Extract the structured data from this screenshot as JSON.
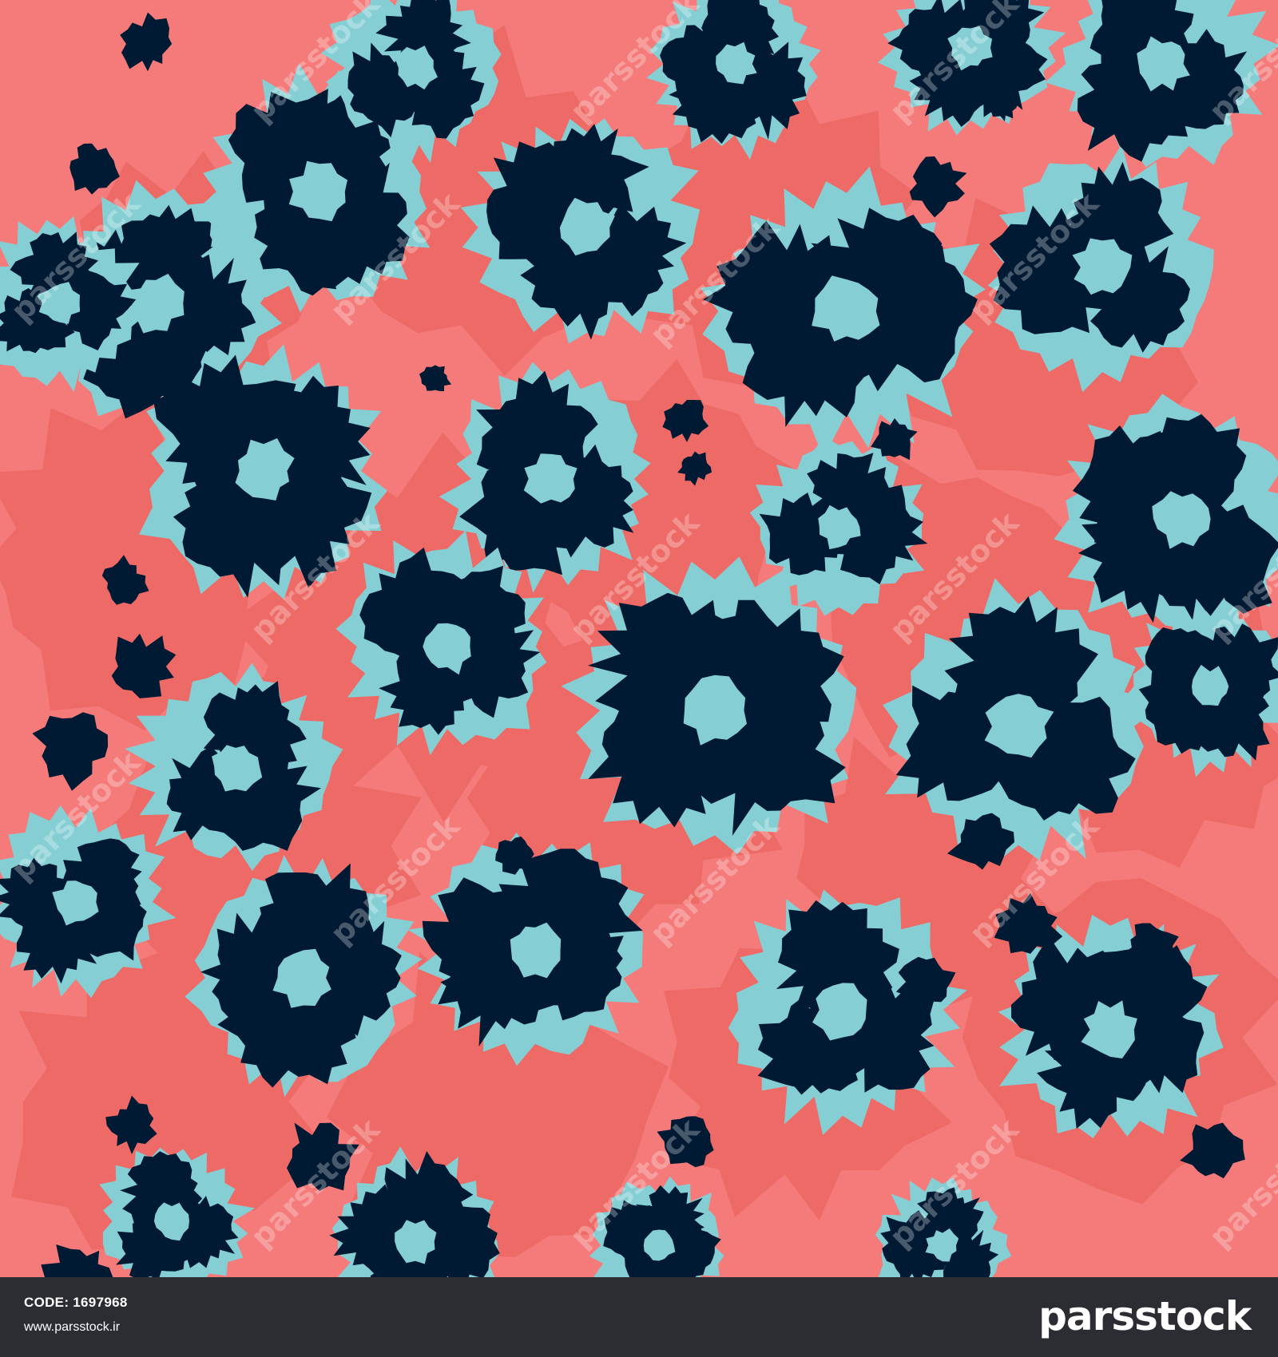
{
  "image": {
    "subject": "seamless leopard print pattern",
    "colors": {
      "background": "#f47b7a",
      "patch": "#ee6a66",
      "spot": "#001a33",
      "inner": "#85cfd4",
      "footer": "#2b2d33"
    }
  },
  "watermark": {
    "text": "parsstock",
    "icon": "pars-logo-icon"
  },
  "footer": {
    "code": "CODE: 1697968",
    "url": "www.parsstock.ir",
    "brand": "parsstock"
  }
}
